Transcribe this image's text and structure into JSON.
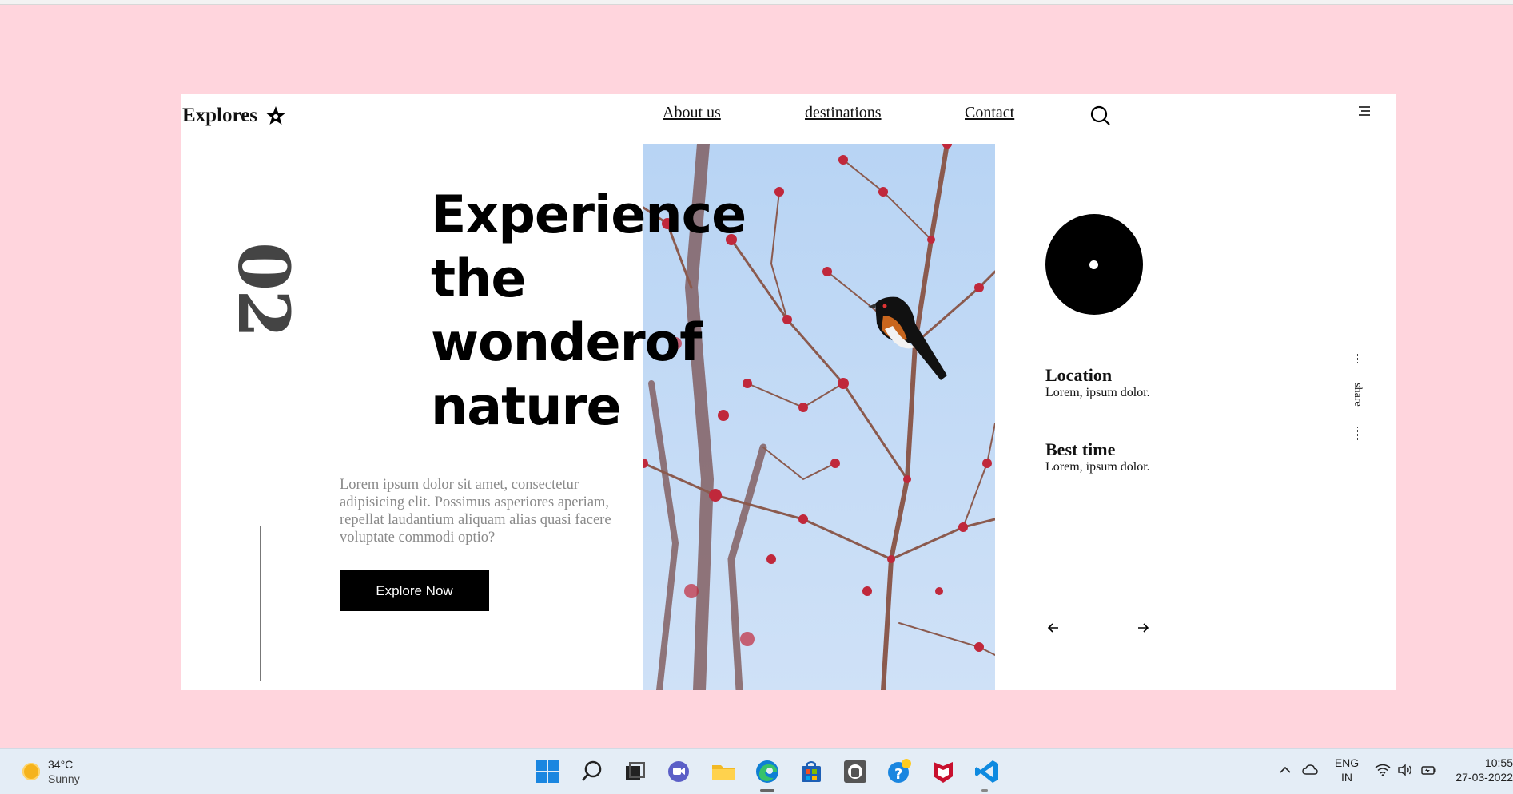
{
  "brand": {
    "name": "Explores"
  },
  "nav": {
    "about": "About us",
    "destinations": "destinations",
    "contact": "Contact"
  },
  "hero": {
    "slide_number": "02",
    "headline": [
      "Experience",
      "the",
      "wonderof",
      "nature"
    ],
    "description": "Lorem ipsum dolor sit amet, consectetur adipisicing elit. Possimus asperiores aperiam, repellat laudantium aliquam alias quasi facere voluptate commodi optio?",
    "cta_label": "Explore Now"
  },
  "info": {
    "location": {
      "title": "Location",
      "text": "Lorem, ipsum dolor."
    },
    "best_time": {
      "title": "Best time",
      "text": "Lorem, ipsum dolor."
    }
  },
  "share_label": "share",
  "taskbar": {
    "weather_temp": "34°C",
    "weather_desc": "Sunny",
    "lang_top": "ENG",
    "lang_bottom": "IN",
    "time": "10:55",
    "date": "27-03-2022",
    "icons": [
      "windows-start-icon",
      "search-icon",
      "task-view-icon",
      "chat-icon",
      "file-explorer-icon",
      "edge-icon",
      "store-icon",
      "app-icon",
      "help-icon",
      "mcafee-icon",
      "vscode-icon"
    ]
  },
  "colors": {
    "page_background": "#ffd5dd",
    "card_background": "#ffffff",
    "button_background": "#000000",
    "text_muted": "#8a8a8a"
  }
}
